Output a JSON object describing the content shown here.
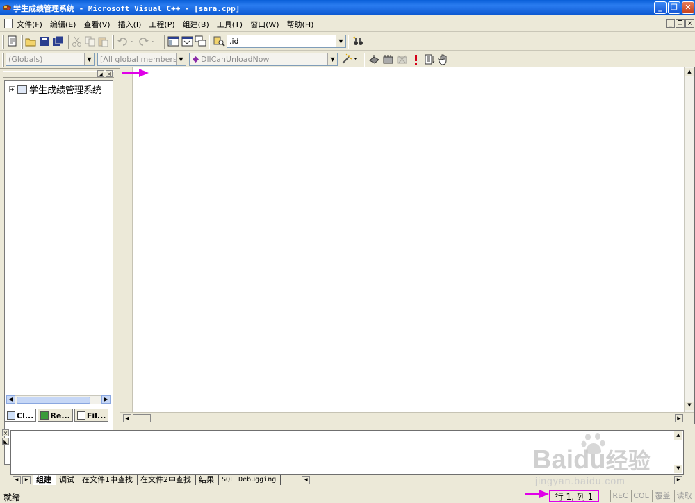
{
  "window": {
    "title": "学生成绩管理系统 - Microsoft Visual C++ - [sara.cpp]",
    "buttons": {
      "minimize": "_",
      "restore": "❐",
      "close": "✕"
    }
  },
  "menu": {
    "items": [
      "文件(F)",
      "编辑(E)",
      "查看(V)",
      "插入(I)",
      "工程(P)",
      "组建(B)",
      "工具(T)",
      "窗口(W)",
      "帮助(H)"
    ],
    "mdi_buttons": [
      "_",
      "❐",
      "×"
    ]
  },
  "toolbar": {
    "find_combo_value": ".id",
    "wizard": {
      "class_combo": "(Globals)",
      "filter_combo": "[All global members",
      "members_combo": "DllCanUnloadNow"
    }
  },
  "workspace": {
    "tree_root": "学生成绩管理系统",
    "tabs": [
      "Cl...",
      "Re...",
      "Fil..."
    ]
  },
  "output": {
    "tabs": [
      "组建",
      "调试",
      "在文件1中查找",
      "在文件2中查找",
      "结果",
      "SQL Debugging"
    ],
    "active_tab": "组建"
  },
  "statusbar": {
    "text": "就绪",
    "position": "行 1, 列 1",
    "indicators": [
      "REC",
      "COL",
      "覆盖",
      "读取"
    ]
  },
  "watermark": {
    "brand": "Baidu",
    "brand_cn": "经验",
    "url": "jingyan.baidu.com"
  },
  "colors": {
    "annotation": "#e000e8",
    "titlebar": "#0a5fd8",
    "chrome": "#ece9d8"
  }
}
